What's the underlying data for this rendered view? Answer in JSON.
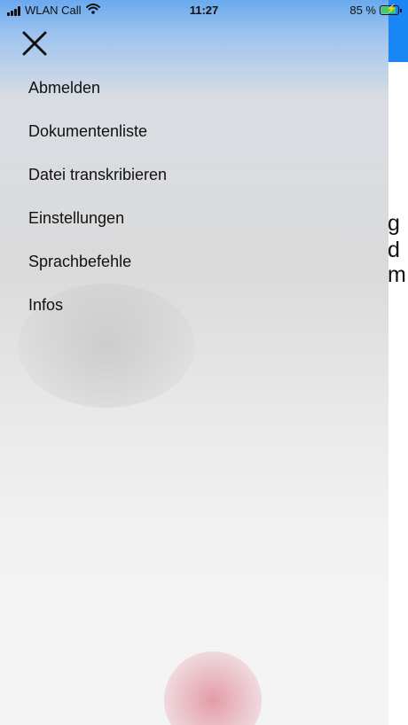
{
  "status_bar": {
    "carrier": "WLAN Call",
    "time": "11:27",
    "battery": "85 %"
  },
  "background": {
    "partial_text": [
      "g",
      "d",
      "m"
    ]
  },
  "drawer": {
    "close_icon": "close-icon",
    "menu_items": [
      "Abmelden",
      "Dokumentenliste",
      "Datei transkribieren",
      "Einstellungen",
      "Sprachbefehle",
      "Infos"
    ]
  },
  "colors": {
    "accent": "#1a85f5",
    "battery_fill": "#3bd15a"
  }
}
